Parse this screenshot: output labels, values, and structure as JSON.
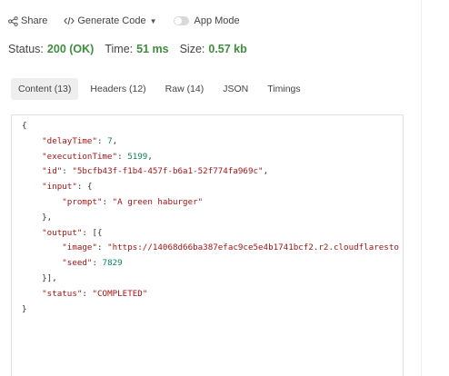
{
  "toolbar": {
    "share_label": "Share",
    "generate_code_label": "Generate Code",
    "app_mode_label": "App Mode",
    "app_mode_enabled": false
  },
  "status": {
    "status_label": "Status:",
    "status_value": "200 (OK)",
    "time_label": "Time:",
    "time_value": "51 ms",
    "size_label": "Size:",
    "size_value": "0.57 kb",
    "value_color": "#3e8f3e"
  },
  "tabs": [
    {
      "label": "Content (13)",
      "active": true
    },
    {
      "label": "Headers (12)",
      "active": false
    },
    {
      "label": "Raw (14)",
      "active": false
    },
    {
      "label": "JSON",
      "active": false
    },
    {
      "label": "Timings",
      "active": false
    }
  ],
  "response": {
    "open_brace": "{",
    "delayTime_key": "\"delayTime\"",
    "delayTime_value": "7",
    "executionTime_key": "\"executionTime\"",
    "executionTime_value": "5199",
    "id_key": "\"id\"",
    "id_value": "\"5bcfb43f-f1b4-457f-b6a1-52f774fa969c\"",
    "input_key": "\"input\"",
    "prompt_key": "\"prompt\"",
    "prompt_value": "\"A green haburger\"",
    "output_key": "\"output\"",
    "image_key": "\"image\"",
    "image_value": "\"https://14068d66ba387efac9ce5e4b1741bcf2.r2.cloudflaresto",
    "seed_key": "\"seed\"",
    "seed_value": "7829",
    "status_key": "\"status\"",
    "status_value": "\"COMPLETED\"",
    "close_brace": "}"
  }
}
